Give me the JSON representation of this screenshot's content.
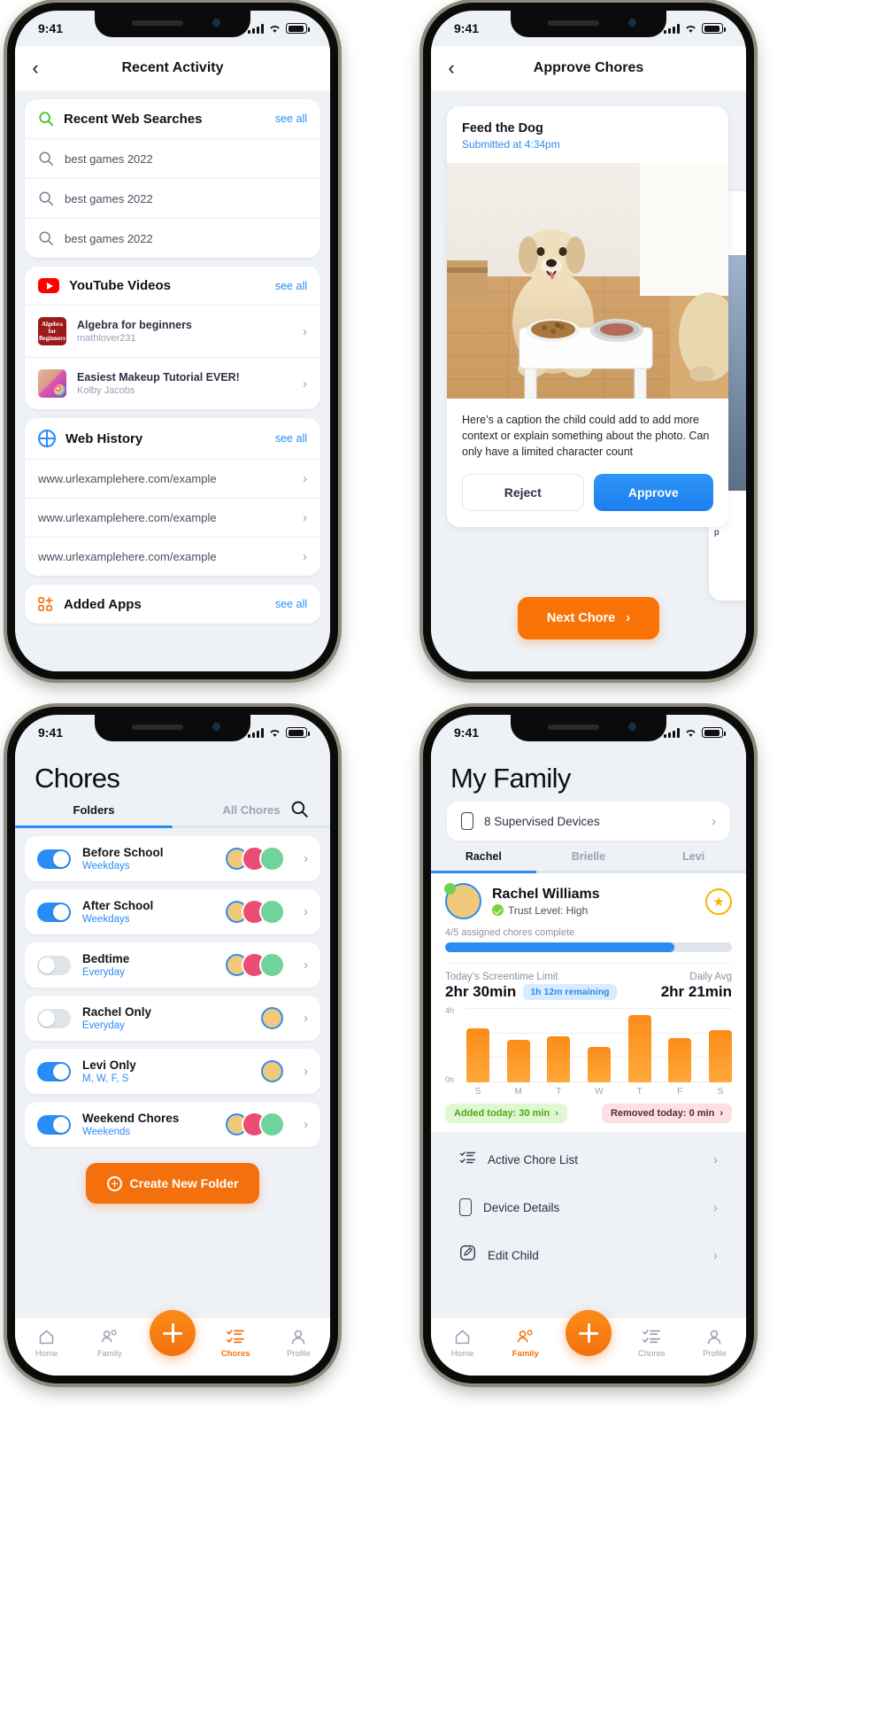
{
  "status_bar": {
    "time": "9:41"
  },
  "screen1": {
    "nav_title": "Recent Activity",
    "back_icon": "chevron-left-icon",
    "sections": [
      {
        "title": "Recent Web Searches",
        "icon": "search-icon-green",
        "see_all": "see all",
        "items": [
          {
            "text": "best games 2022"
          },
          {
            "text": "best games 2022"
          },
          {
            "text": "best games 2022"
          }
        ]
      },
      {
        "title": "YouTube Videos",
        "icon": "youtube-icon",
        "see_all": "see all",
        "videos": [
          {
            "title": "Algebra for beginners",
            "channel": "mathlover231",
            "thumb_text": "Algebra for Beginners"
          },
          {
            "title": "Easiest Makeup Tutorial EVER!",
            "channel": "Kolby Jacobs",
            "thumb_text": ""
          }
        ]
      },
      {
        "title": "Web History",
        "icon": "globe-icon",
        "see_all": "see all",
        "urls": [
          {
            "text": "www.urlexamplehere.com/example"
          },
          {
            "text": "www.urlexamplehere.com/example"
          },
          {
            "text": "www.urlexamplehere.com/example"
          }
        ]
      },
      {
        "title": "Added Apps",
        "icon": "apps-icon",
        "see_all": "see all",
        "items": []
      }
    ]
  },
  "screen2": {
    "nav_title": "Approve Chores",
    "back_icon": "chevron-left-icon",
    "chore": {
      "title": "Feed the Dog",
      "submitted": "Submitted at 4:34pm",
      "caption": "Here’s a caption the child could add to add more context or explain something about the photo. Can only have a limited character count",
      "reject_label": "Reject",
      "approve_label": "Approve"
    },
    "next_button": {
      "label": "Next Chore",
      "icon": "chevron-right-icon"
    }
  },
  "screen3": {
    "page_title": "Chores",
    "search_icon": "search-icon",
    "tabs": [
      {
        "label": "Folders",
        "active": true
      },
      {
        "label": "All Chores",
        "active": false
      }
    ],
    "folders": [
      {
        "name": "Before School",
        "schedule": "Weekdays",
        "enabled": true,
        "avatars": [
          "rachel",
          "brielle",
          "levi"
        ]
      },
      {
        "name": "After School",
        "schedule": "Weekdays",
        "enabled": true,
        "avatars": [
          "rachel",
          "brielle",
          "levi"
        ]
      },
      {
        "name": "Bedtime",
        "schedule": "Everyday",
        "enabled": false,
        "avatars": [
          "rachel",
          "brielle",
          "levi"
        ]
      },
      {
        "name": "Rachel Only",
        "schedule": "Everyday",
        "enabled": false,
        "avatars": [
          "rachel"
        ]
      },
      {
        "name": "Levi Only",
        "schedule": "M, W, F, S",
        "enabled": true,
        "avatars": [
          "rachel"
        ]
      },
      {
        "name": "Weekend Chores",
        "schedule": "Weekends",
        "enabled": true,
        "avatars": [
          "rachel",
          "brielle",
          "levi"
        ]
      }
    ],
    "create_button": "Create New Folder",
    "tabbar": [
      {
        "label": "Home",
        "icon": "home-icon",
        "active": false
      },
      {
        "label": "Family",
        "icon": "people-icon",
        "active": false
      },
      {
        "label": "Chores",
        "icon": "checklist-icon",
        "active": true
      },
      {
        "label": "Profile",
        "icon": "person-icon",
        "active": false
      }
    ],
    "fab_icon": "plus-icon"
  },
  "screen4": {
    "page_title": "My Family",
    "devices_row": {
      "label": "8 Supervised Devices",
      "icon": "phone-icon",
      "chevron": "chevron-right-icon"
    },
    "child_tabs": [
      {
        "label": "Rachel",
        "active": true
      },
      {
        "label": "Brielle",
        "active": false
      },
      {
        "label": "Levi",
        "active": false
      }
    ],
    "profile": {
      "name": "Rachel Williams",
      "trust": "Trust Level: High",
      "star_icon": "star-icon",
      "chores_complete": "4/5 assigned chores complete",
      "progress_percent": 80
    },
    "screentime": {
      "limit_label": "Today’s Screentime Limit",
      "limit_value": "2hr 30min",
      "remaining_pill": "1h 12m remaining",
      "avg_label": "Daily Avg",
      "avg_value": "2hr 21min"
    },
    "badges": [
      {
        "text": "Added today: 30 min",
        "tone": "green"
      },
      {
        "text": "Removed today: 0 min",
        "tone": "red"
      }
    ],
    "menu": [
      {
        "label": "Active Chore List",
        "icon": "checklist-icon"
      },
      {
        "label": "Device Details",
        "icon": "phone-icon"
      },
      {
        "label": "Edit Child",
        "icon": "edit-icon"
      }
    ],
    "tabbar": [
      {
        "label": "Home",
        "icon": "home-icon",
        "active": false
      },
      {
        "label": "Family",
        "icon": "people-icon",
        "active": true
      },
      {
        "label": "Chores",
        "icon": "checklist-icon",
        "active": false
      },
      {
        "label": "Profile",
        "icon": "person-icon",
        "active": false
      }
    ],
    "fab_icon": "plus-icon",
    "chart_data": {
      "type": "bar",
      "title": "Today’s Screentime Limit",
      "categories": [
        "S",
        "M",
        "T",
        "W",
        "T",
        "F",
        "S"
      ],
      "values": [
        2.9,
        2.3,
        2.5,
        1.9,
        3.6,
        2.4,
        2.8
      ],
      "ylabel": "",
      "ytick_labels": [
        "0h",
        "4h"
      ],
      "ylim": [
        0,
        4
      ],
      "grid": true,
      "legend": false,
      "bar_color": "#fb8c18"
    }
  }
}
